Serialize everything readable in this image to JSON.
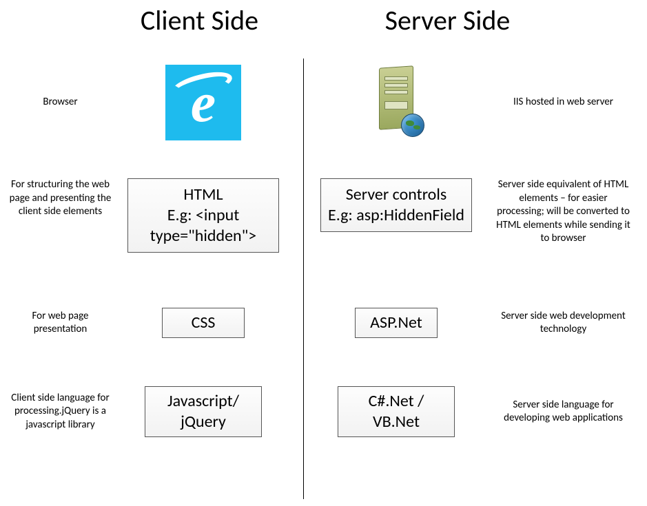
{
  "headers": {
    "client": "Client Side",
    "server": "Server Side"
  },
  "rows": [
    {
      "left_desc": "Browser",
      "right_desc": "IIS hosted in web server"
    },
    {
      "left_desc": "For structuring the web page and presenting the client side elements",
      "client_box": "HTML\nE.g: <input type=\"hidden\">",
      "server_box": "Server controls\nE.g: asp:HiddenField",
      "right_desc": "Server side equivalent of HTML elements – for easier processing; will be converted to HTML elements while sending it to browser"
    },
    {
      "left_desc": "For web page presentation",
      "client_box": "CSS",
      "server_box": "ASP.Net",
      "right_desc": "Server side web development technology"
    },
    {
      "left_desc": "Client side language for processing.jQuery is a javascript library",
      "client_box": "Javascript/ jQuery",
      "server_box": "C#.Net / VB.Net",
      "right_desc": "Server side language for developing web applications"
    }
  ]
}
